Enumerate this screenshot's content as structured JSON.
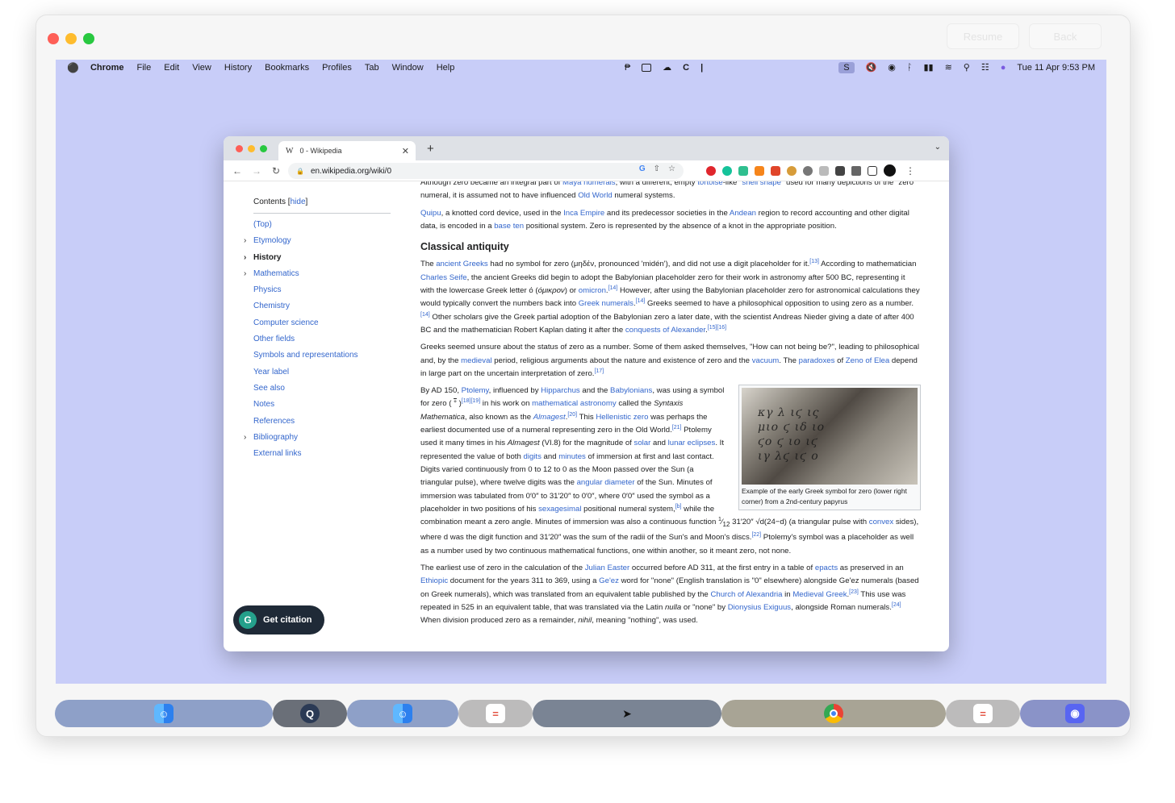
{
  "window_controls": {
    "resume_label": "Resume",
    "back_label": "Back"
  },
  "menubar": {
    "apple": "",
    "items": [
      "Chrome",
      "File",
      "Edit",
      "View",
      "History",
      "Bookmarks",
      "Profiles",
      "Tab",
      "Window",
      "Help"
    ],
    "status_badge": "S",
    "datetime": "Tue 11 Apr  9:53 PM"
  },
  "browser": {
    "tab_title": "0 - Wikipedia",
    "tab_favicon": "W",
    "url": "en.wikipedia.org/wiki/0"
  },
  "toc": {
    "title": "Contents",
    "hide_label": "hide",
    "items": [
      {
        "label": "(Top)",
        "expandable": false,
        "bold": false
      },
      {
        "label": "Etymology",
        "expandable": true,
        "bold": false
      },
      {
        "label": "History",
        "expandable": true,
        "bold": true
      },
      {
        "label": "Mathematics",
        "expandable": true,
        "bold": false
      },
      {
        "label": "Physics",
        "expandable": false,
        "bold": false
      },
      {
        "label": "Chemistry",
        "expandable": false,
        "bold": false
      },
      {
        "label": "Computer science",
        "expandable": false,
        "bold": false
      },
      {
        "label": "Other fields",
        "expandable": false,
        "bold": false
      },
      {
        "label": "Symbols and representations",
        "expandable": false,
        "bold": false
      },
      {
        "label": "Year label",
        "expandable": false,
        "bold": false
      },
      {
        "label": "See also",
        "expandable": false,
        "bold": false
      },
      {
        "label": "Notes",
        "expandable": false,
        "bold": false
      },
      {
        "label": "References",
        "expandable": false,
        "bold": false
      },
      {
        "label": "Bibliography",
        "expandable": true,
        "bold": false
      },
      {
        "label": "External links",
        "expandable": false,
        "bold": false
      }
    ]
  },
  "article": {
    "heading_classical": "Classical antiquity",
    "figure_caption": "Example of the early Greek symbol for zero (lower right corner) from a 2nd-century papyrus"
  },
  "citation_button": {
    "icon": "G",
    "label": "Get citation"
  },
  "dock": {
    "apps": [
      "finder",
      "quicktime",
      "finder",
      "calculator",
      "mouse-cursor",
      "chrome",
      "calculator",
      "discord"
    ]
  }
}
